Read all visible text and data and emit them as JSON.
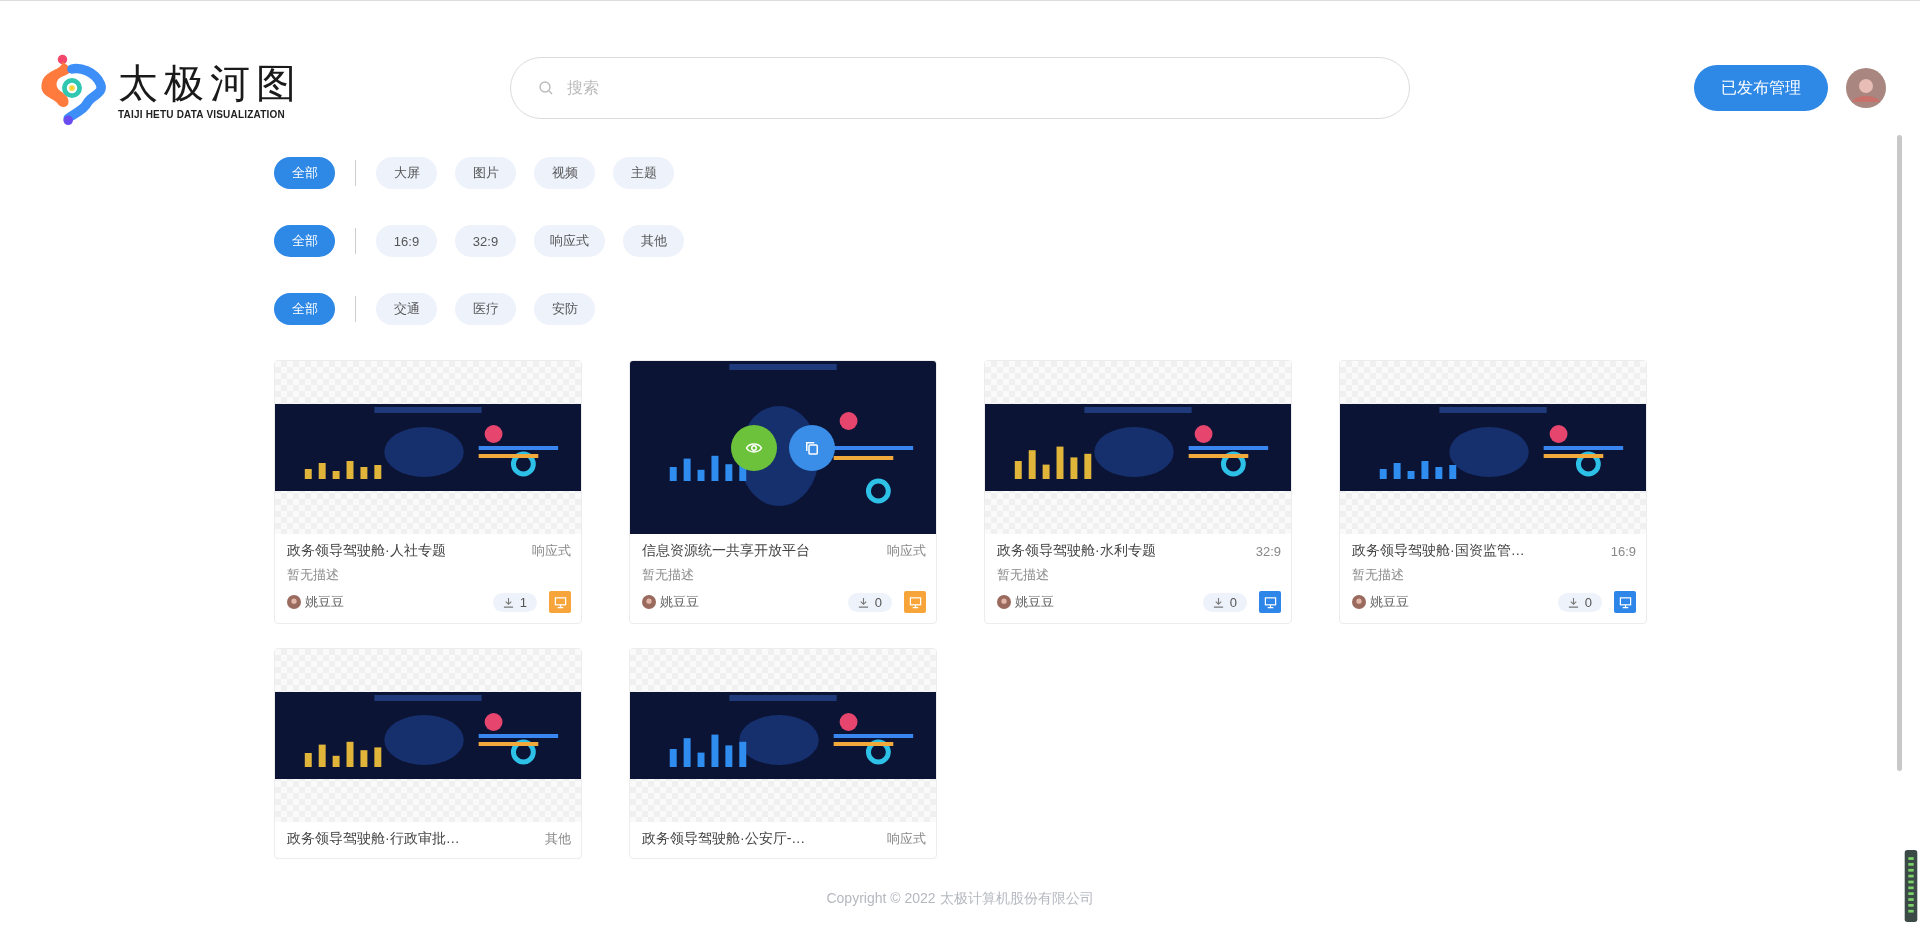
{
  "header": {
    "logo": {
      "title": "太极河图",
      "subtitle": "TAIJI HETU DATA VISUALIZATION"
    },
    "search": {
      "placeholder": "搜索"
    },
    "publish_button": "已发布管理"
  },
  "filters": [
    {
      "chips": [
        {
          "label": "全部",
          "selected": true
        },
        {
          "label": "大屏",
          "selected": false
        },
        {
          "label": "图片",
          "selected": false
        },
        {
          "label": "视频",
          "selected": false
        },
        {
          "label": "主题",
          "selected": false
        }
      ]
    },
    {
      "chips": [
        {
          "label": "全部",
          "selected": true
        },
        {
          "label": "16:9",
          "selected": false
        },
        {
          "label": "32:9",
          "selected": false
        },
        {
          "label": "响应式",
          "selected": false
        },
        {
          "label": "其他",
          "selected": false
        }
      ]
    },
    {
      "chips": [
        {
          "label": "全部",
          "selected": true
        },
        {
          "label": "交通",
          "selected": false
        },
        {
          "label": "医疗",
          "selected": false
        },
        {
          "label": "安防",
          "selected": false
        }
      ]
    }
  ],
  "cards": [
    {
      "title": "政务领导驾驶舱·人社专题",
      "ratio": "响应式",
      "description": "暂无描述",
      "author": "姚豆豆",
      "downloads": "1",
      "color": "#f7a43a",
      "hovered": false
    },
    {
      "title": "信息资源统一共享开放平台",
      "ratio": "响应式",
      "description": "暂无描述",
      "author": "姚豆豆",
      "downloads": "0",
      "color": "#f7a43a",
      "hovered": true
    },
    {
      "title": "政务领导驾驶舱·水利专题",
      "ratio": "32:9",
      "description": "暂无描述",
      "author": "姚豆豆",
      "downloads": "0",
      "color": "#2e86e8",
      "hovered": false
    },
    {
      "title": "政务领导驾驶舱·国资监管…",
      "ratio": "16:9",
      "description": "暂无描述",
      "author": "姚豆豆",
      "downloads": "0",
      "color": "#2e86e8",
      "hovered": false
    },
    {
      "title": "政务领导驾驶舱·行政审批…",
      "ratio": "其他",
      "hovered": false
    },
    {
      "title": "政务领导驾驶舱·公安厅-…",
      "ratio": "响应式",
      "hovered": false
    }
  ],
  "footer": "Copyright © 2022 太极计算机股份有限公司"
}
